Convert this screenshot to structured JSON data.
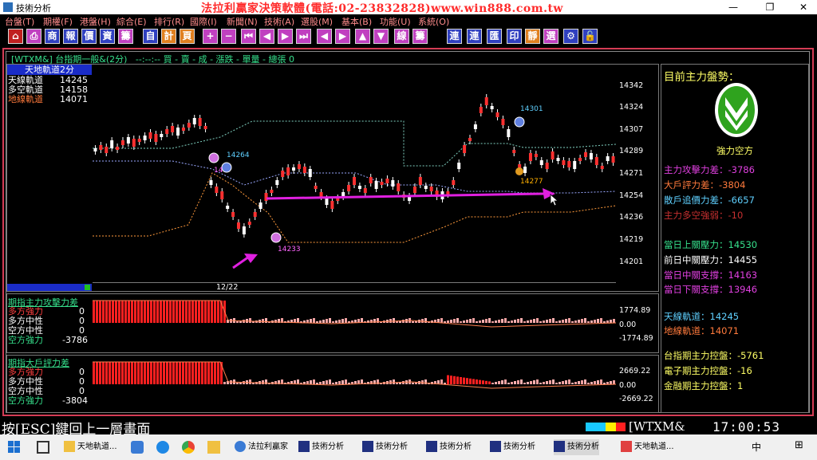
{
  "window": {
    "title": "技術分析",
    "controls": [
      "—",
      "❐",
      "✕"
    ]
  },
  "menu": {
    "items": [
      "台盤(T)",
      "期權(F)",
      "港盤(H)",
      "綜合(E)",
      "排行(R)",
      "國際(I)",
      "新聞(N)",
      "技術(A)",
      "選股(M)",
      "基本(B)",
      "功能(U)",
      "系統(O)"
    ],
    "banner": "法拉利贏家決策軟體(電話:02-23832828)www.win888.com.tw"
  },
  "toolbar": {
    "buttons": [
      "⌂",
      "⎙",
      "商",
      "報",
      "價",
      "資",
      "籌",
      "自",
      "計",
      "頁",
      "+",
      "−",
      "⏮",
      "◀",
      "▶",
      "⏭",
      "◀",
      "▶",
      "▲",
      "▼",
      "線",
      "籌",
      "連",
      "連",
      "匯",
      "印",
      "靜",
      "選",
      "⚙",
      "🔓"
    ]
  },
  "chart_header": "[WTXM&] 台指期一般&(2分)   --:--:-- 買 - 賣 - 成 - 漲跌 - 單量 - 總張 0",
  "indicator_legend": {
    "title": "天地軌道2分",
    "rows": [
      {
        "label": "天線軌道",
        "value": "14245",
        "color": "#ffffff"
      },
      {
        "label": "多空軌道",
        "value": "14158",
        "color": "#ffffff"
      },
      {
        "label": "地線軌道",
        "value": "14071",
        "color": "#ff7a3c"
      }
    ]
  },
  "price_axis": [
    "14342",
    "14324",
    "14307",
    "14289",
    "14271",
    "14254",
    "14236",
    "14219",
    "14201"
  ],
  "date_label": "12/22",
  "chart_annotations": [
    {
      "text": "14264",
      "color": "#5fd0ff"
    },
    {
      "text": "14233",
      "color": "#ff66ff"
    },
    {
      "text": "14301",
      "color": "#5fd0ff"
    },
    {
      "text": "14277",
      "color": "#ffb000"
    },
    {
      "text": "14",
      "color": "#ff66ff"
    }
  ],
  "sub1": {
    "title": "期指主力攻擊力差",
    "rows": [
      {
        "label": "多方強力",
        "value": "0",
        "color": "#ff4040"
      },
      {
        "label": "多方中性",
        "value": "0",
        "color": "#ffffff"
      },
      {
        "label": "空方中性",
        "value": "0",
        "color": "#ffffff"
      },
      {
        "label": "空方強力",
        "value": "-3786",
        "color": "#36e08c"
      }
    ],
    "axis": [
      "1774.89",
      "0.00",
      "-1774.89"
    ]
  },
  "sub2": {
    "title": "期指大戶評力差",
    "rows": [
      {
        "label": "多方強力",
        "value": "0",
        "color": "#ff4040"
      },
      {
        "label": "多方中性",
        "value": "0",
        "color": "#ffffff"
      },
      {
        "label": "空方中性",
        "value": "0",
        "color": "#ffffff"
      },
      {
        "label": "空方強力",
        "value": "-3804",
        "color": "#36e08c"
      }
    ],
    "axis": [
      "2669.22",
      "0.00",
      "-2669.22"
    ]
  },
  "right_panel": {
    "title": "目前主力盤勢：",
    "status": "強力空方",
    "stats": [
      {
        "text": "主力攻擊力差：-3786",
        "color": "#e040e0"
      },
      {
        "text": "大戶評力差：-3804",
        "color": "#ff7a3c"
      },
      {
        "text": "散戶追價力差：-6657",
        "color": "#5fd0ff"
      },
      {
        "text": "主力多空強弱：-10",
        "color": "#c83030"
      },
      {
        "text": "當日上關壓力：14530",
        "color": "#36e08c"
      },
      {
        "text": "前日中關壓力：14455",
        "color": "#ffffff"
      },
      {
        "text": "當日中關支撐：14163",
        "color": "#e040e0"
      },
      {
        "text": "當日下關支撐：13946",
        "color": "#e040e0"
      },
      {
        "text": "天線軌道：14245",
        "color": "#5fd0ff"
      },
      {
        "text": "地線軌道：14071",
        "color": "#ff7a3c"
      },
      {
        "text": "台指期主力控盤：-5761",
        "color": "#ffff66"
      },
      {
        "text": "電子期主力控盤：-16",
        "color": "#ffff66"
      },
      {
        "text": "金融期主力控盤：1",
        "color": "#ffff66"
      }
    ]
  },
  "statusbar": {
    "hint": "按[ESC]鍵回上一層畫面",
    "symbol": "[WTXM&",
    "time": "17:00:53"
  },
  "taskbar": {
    "items": [
      "天地軌道...",
      "法拉利贏家",
      "技術分析",
      "技術分析",
      "技術分析",
      "技術分析",
      "技術分析",
      "天地軌道..."
    ],
    "tray": [
      "中",
      "⊞"
    ]
  },
  "colors": {
    "frame": "#d43c55",
    "up_candle": "#ff3030",
    "down_candle": "#ffffff",
    "arrow": "#e020e0",
    "accent_green": "#36e08c"
  }
}
